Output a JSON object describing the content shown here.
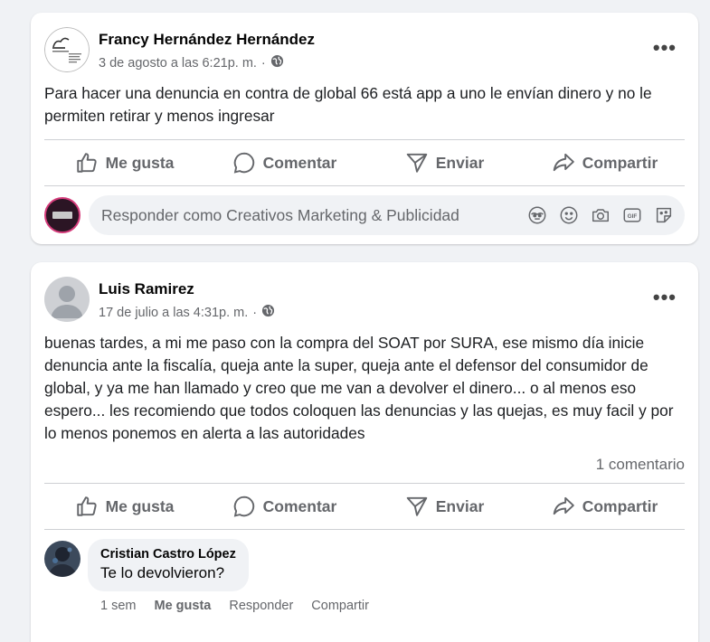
{
  "posts": [
    {
      "author": "Francy Hernández Hernández",
      "timestamp": "3 de agosto a las 6:21p. m.",
      "privacy_icon": "globe-icon",
      "more_label": "•••",
      "text": "Para hacer una denuncia en contra de global  66 está app  a uno le envían dinero y no le permiten retirar y menos ingresar",
      "actions": [
        "Me gusta",
        "Comentar",
        "Enviar",
        "Compartir"
      ],
      "reply_placeholder": "Responder como Creativos Marketing & Publicidad"
    },
    {
      "author": "Luis Ramirez",
      "timestamp": "17 de julio a las 4:31p. m.",
      "privacy_icon": "globe-icon",
      "more_label": "•••",
      "text": "buenas tardes, a mi me paso con la compra del SOAT por SURA, ese mismo día inicie denuncia ante la fiscalía, queja ante la super, queja ante el defensor del consumidor de global, y ya me han llamado y creo que me van a devolver el dinero... o al menos eso espero... les recomiendo que todos coloquen las denuncias y las quejas, es muy facil y por lo menos ponemos en alerta a las autoridades",
      "comment_count": "1 comentario",
      "actions": [
        "Me gusta",
        "Comentar",
        "Enviar",
        "Compartir"
      ],
      "comment": {
        "author": "Cristian Castro López",
        "text": "Te lo devolvieron?",
        "time": "1 sem",
        "like": "Me gusta",
        "reply": "Responder",
        "share": "Compartir"
      }
    }
  ],
  "colors": {
    "background": "#f0f2f5",
    "card": "#ffffff",
    "muted": "#65676b",
    "divider": "#ced0d4"
  }
}
